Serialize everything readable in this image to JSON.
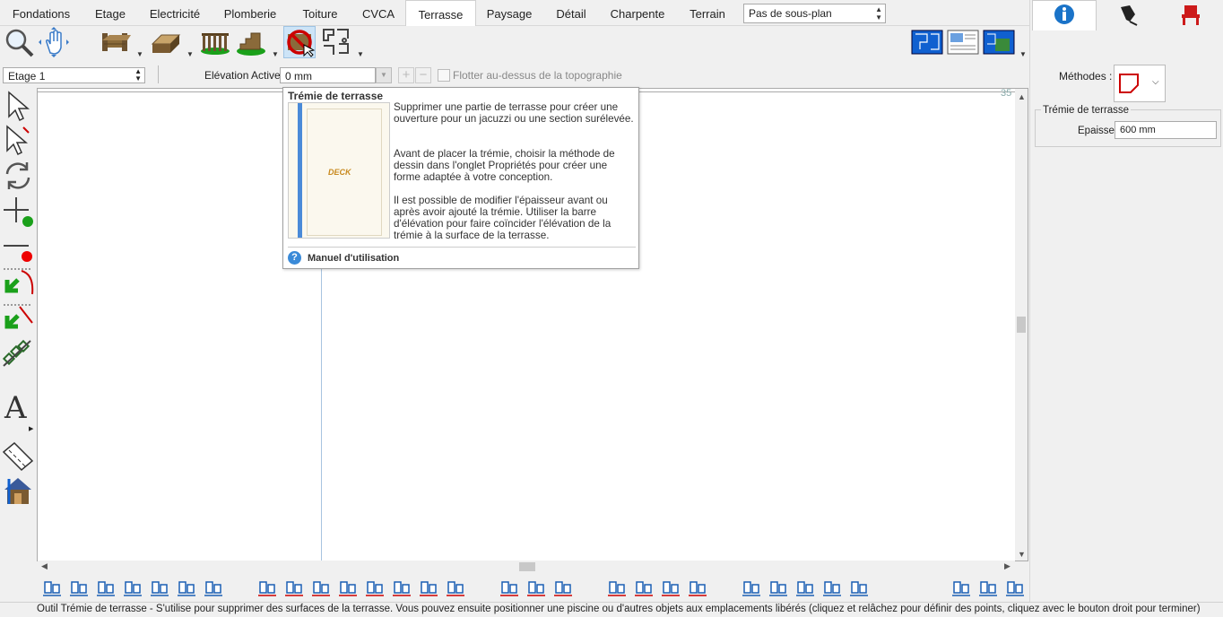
{
  "tabs": [
    {
      "label": "Fondations",
      "active": false
    },
    {
      "label": "Etage",
      "active": false
    },
    {
      "label": "Electricité",
      "active": false
    },
    {
      "label": "Plomberie",
      "active": false
    },
    {
      "label": "Toiture",
      "active": false
    },
    {
      "label": "CVCA",
      "active": false
    },
    {
      "label": "Terrasse",
      "active": true
    },
    {
      "label": "Paysage",
      "active": false
    },
    {
      "label": "Détail",
      "active": false
    },
    {
      "label": "Charpente",
      "active": false
    },
    {
      "label": "Terrain",
      "active": false
    }
  ],
  "subplan": {
    "selected": "Pas de sous-plan"
  },
  "toolbar": {
    "icons": [
      "zoom-icon",
      "pan-icon",
      "deck-stairs-icon",
      "deck-icon",
      "railing-icon",
      "deck-steps-icon",
      "deck-cutout-icon",
      "framing-icon"
    ],
    "view_icons": [
      "plan-view-icon",
      "page-view-icon",
      "site-view-icon"
    ]
  },
  "elevation": {
    "floor_selected": "Etage 1",
    "label": "Elévation Active:",
    "value": "0 mm",
    "float_label": "Flotter au-dessus de la topographie"
  },
  "canvas": {
    "ruler_number": "35"
  },
  "tooltip": {
    "title": "Trémie de terrasse",
    "image_text": "DECK",
    "paragraphs": [
      "Supprimer une partie de terrasse pour créer une ouverture pour un jacuzzi ou une section surélevée.",
      "Avant de placer la trémie, choisir la méthode de dessin dans l'onglet Propriétés pour créer une forme adaptée à votre conception.",
      "Il est possible de modifier l'épaisseur avant ou après avoir ajouté la trémie. Utiliser la barre d'élévation pour faire coïncider l'élévation de la trémie à la surface de la terrasse."
    ],
    "manual_link": "Manuel d'utilisation"
  },
  "right_panel": {
    "tabs": [
      "info-icon",
      "pen-icon",
      "chair-icon"
    ],
    "methods_label": "Méthodes :",
    "group_label": "Trémie de terrasse",
    "thickness_label": "Epaisseur:",
    "thickness_value": "600 mm"
  },
  "status_text": "Outil Trémie de terrasse - S'utilise pour supprimer des surfaces de la terrasse.  Vous pouvez ensuite positionner une piscine ou d'autres objets aux emplacements libérés (cliquez et relâchez pour définir des points, cliquez avec le bouton droit pour terminer)",
  "colors": {
    "accent": "#1a73c8",
    "highlight": "#cde4f7",
    "red": "#cc0000",
    "green": "#1aa01a"
  }
}
